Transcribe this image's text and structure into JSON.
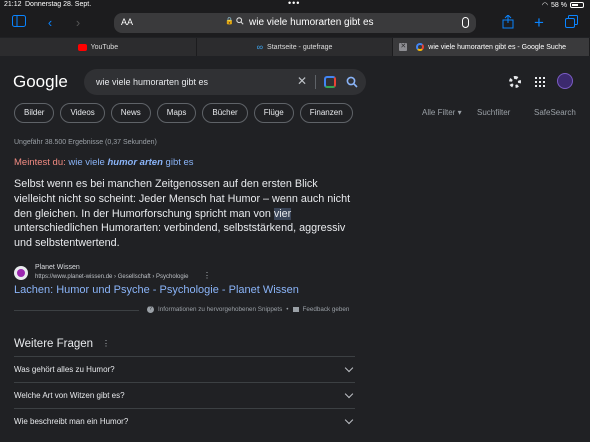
{
  "status_bar": {
    "time": "21:12",
    "date": "Donnerstag 28. Sept.",
    "battery": "58 %",
    "battery_level": 0.58
  },
  "browser": {
    "reader_label": "AA",
    "url_text": "wie viele humorarten gibt es",
    "tabs": [
      {
        "title": "YouTube",
        "favicon": "youtube-icon",
        "color": "#ff0000"
      },
      {
        "title": "Startseite - gutefrage",
        "favicon": "infinity-icon",
        "color": "#3fa9f5"
      },
      {
        "title": "wie viele humorarten gibt es - Google Suche",
        "favicon": "google-icon",
        "color": "#4285f4",
        "active": true
      }
    ]
  },
  "google": {
    "logo": "Google",
    "query": "wie viele humorarten gibt es",
    "chips": [
      "Bilder",
      "Videos",
      "News",
      "Maps",
      "Bücher",
      "Flüge",
      "Finanzen"
    ],
    "all_filters": "Alle Filter",
    "search_filter": "Suchfilter",
    "safesearch": "SafeSearch",
    "result_stats": "Ungefähr 38.500 Ergebnisse (0,37 Sekunden)",
    "did_you_mean": {
      "label": "Meintest du:",
      "pre": "wie viele",
      "bold": "humor arten",
      "post": "gibt es"
    },
    "snippet": {
      "before": "Selbst wenn es bei manchen Zeitgenossen auf den ersten Blick vielleicht nicht so scheint: Jeder Mensch hat Humor – wenn auch nicht den gleichen. In der Humorforschung spricht man von",
      "highlight": "vier",
      "after": "unterschiedlichen Humorarten: verbindend, selbststärkend, aggressiv und selbstentwertend."
    },
    "source": {
      "site_name": "Planet Wissen",
      "breadcrumb": "https://www.planet-wissen.de › Gesellschaft › Psychologie",
      "title": "Lachen: Humor und Psyche - Psychologie - Planet Wissen"
    },
    "about_snippets": "Informationen zu hervorgehobenen Snippets",
    "feedback": "Feedback geben",
    "people_also_ask": {
      "title": "Weitere Fragen",
      "questions": [
        "Was gehört alles zu Humor?",
        "Welche Art von Witzen gibt es?",
        "Wie beschreibt man ein Humor?"
      ]
    }
  }
}
